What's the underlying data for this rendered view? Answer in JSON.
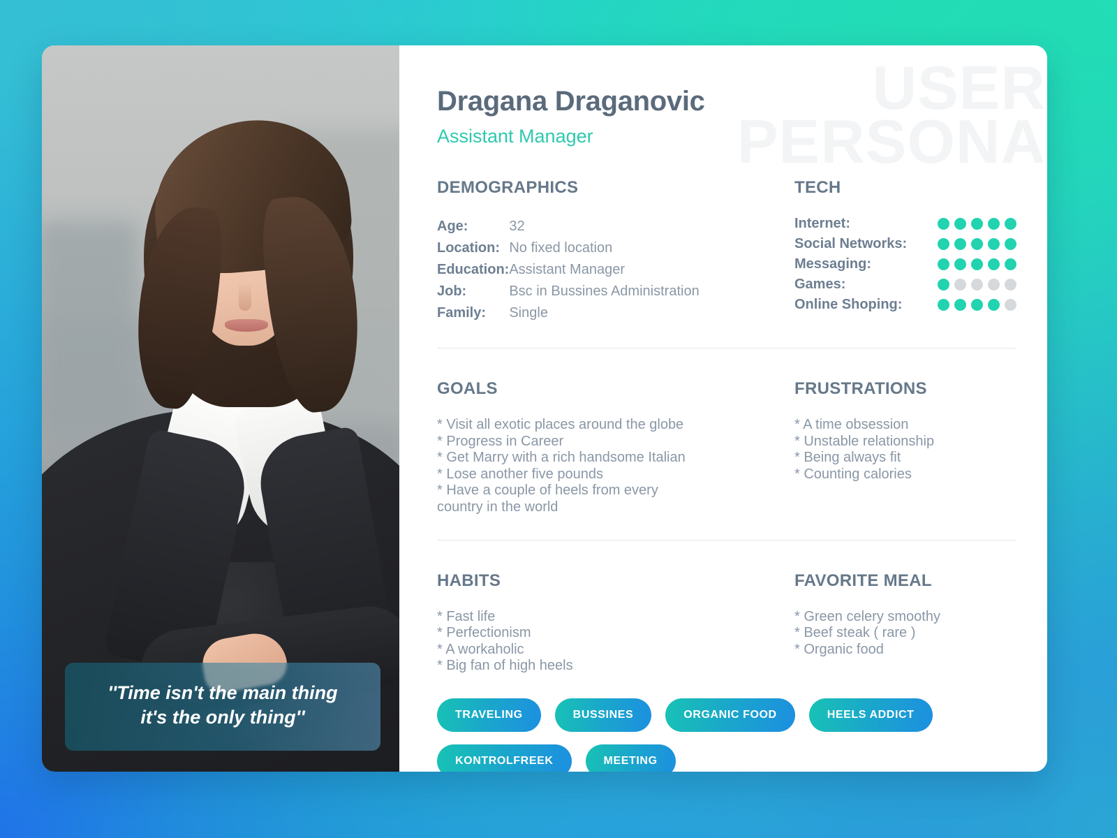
{
  "background": {
    "gradient_colors": [
      "#35bfd4",
      "#22ddb5",
      "#2073e8",
      "#2ba7d4"
    ]
  },
  "watermark": "USER\nPERSONA",
  "accent_color": "#2fc9ae",
  "header": {
    "name": "Dragana Draganovic",
    "role": "Assistant Manager"
  },
  "quote": "''Time isn't the main thing\nit's the only thing''",
  "demographics": {
    "title": "DEMOGRAPHICS",
    "rows": [
      {
        "label": "Age:",
        "value": "32"
      },
      {
        "label": "Location:",
        "value": "No fixed location"
      },
      {
        "label": "Education:",
        "value": "Assistant Manager"
      },
      {
        "label": "Job:",
        "value": "Bsc in Bussines Administration"
      },
      {
        "label": "Family:",
        "value": "Single"
      }
    ]
  },
  "tech": {
    "title": "TECH",
    "max_rating": 5,
    "rows": [
      {
        "label": "Internet:",
        "rating": 5
      },
      {
        "label": "Social Networks:",
        "rating": 5
      },
      {
        "label": "Messaging:",
        "rating": 5
      },
      {
        "label": "Games:",
        "rating": 1
      },
      {
        "label": "Online Shoping:",
        "rating": 4
      }
    ]
  },
  "goals": {
    "title": "GOALS",
    "items": "* Visit all exotic places around the globe\n* Progress in Career\n* Get Marry with a rich handsome Italian\n* Lose another five pounds\n* Have a couple of heels from every\n   country in the world"
  },
  "frustrations": {
    "title": "FRUSTRATIONS",
    "items": "* A time obsession\n* Unstable relationship\n* Being always fit\n* Counting calories"
  },
  "habits": {
    "title": "HABITS",
    "items": "* Fast life\n* Perfectionism\n* A workaholic\n* Big fan of high heels"
  },
  "favorite_meal": {
    "title": "FAVORITE MEAL",
    "items": "* Green celery smoothy\n* Beef steak ( rare )\n* Organic food"
  },
  "tags": [
    "TRAVELING",
    "BUSSINES",
    "ORGANIC FOOD",
    "HEELS ADDICT",
    "KONTROLFREEK",
    "MEETING"
  ]
}
